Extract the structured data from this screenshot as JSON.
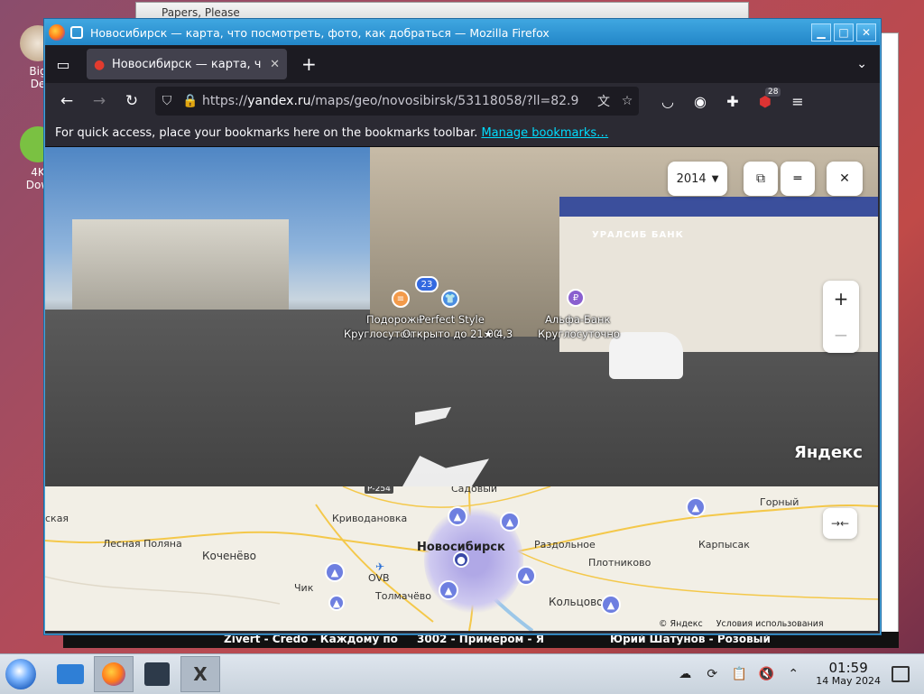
{
  "desktop": {
    "icons": [
      {
        "label_line1": "Big",
        "label_line2": "De"
      },
      {
        "label_line1": "4K",
        "label_line2": "Dow"
      }
    ]
  },
  "bg_window": {
    "title": "Papers, Please"
  },
  "now_playing": {
    "track1": "Zivert - Credo - Каждому по",
    "track2": "3002 - Примером - Я",
    "track3": "Юрий Шатунов - Розовый"
  },
  "firefox": {
    "window_title": "Новосибирск — карта, что посмотреть, фото, как добраться — Mozilla Firefox",
    "tab_title": "Новосибирск — карта, ч",
    "url_host_prefix": "https://",
    "url_host": "yandex.ru",
    "url_path": "/maps/geo/novosibirsk/53118058/?ll=82.9",
    "bookmarks_message": "For quick access, place your bookmarks here on the bookmarks toolbar.",
    "bookmarks_link": "Manage bookmarks…",
    "ublock_badge": "28"
  },
  "panorama": {
    "year": "2014",
    "cluster_count": "23",
    "bank_sign": "УРАЛСИБ   БАНК",
    "poi1_name": "Подорожн",
    "poi1_status": "Круглосуточ",
    "poi2_name": "Perfect Style",
    "poi2_status": "Открыто до 21:00",
    "poi2_rating": "★ 4,3",
    "poi3_name": "Альфа-Банк",
    "poi3_status": "Круглосуточно",
    "watermark": "Яндекс"
  },
  "map": {
    "road_badge": "Р-254",
    "towns": {
      "sadovy": "Садовый",
      "krivodanovka": "Криводановка",
      "gorny": "Горный",
      "karpysak": "Карпысак",
      "lesnaya_polyana": "Лесная Поляна",
      "kochenyovo": "Коченёво",
      "novosibirsk": "Новосибирск",
      "razdolnoe": "Раздольное",
      "plotnikovo": "Плотниково",
      "chik": "Чик",
      "ovb": "OVB",
      "tolmachevo": "Толмачёво",
      "koltsovo": "Кольцово",
      "edge_left": "ская"
    },
    "copyright": "© Яндекс",
    "terms": "Условия использования"
  },
  "taskbar": {
    "time": "01:59",
    "date": "14 May 2024"
  }
}
